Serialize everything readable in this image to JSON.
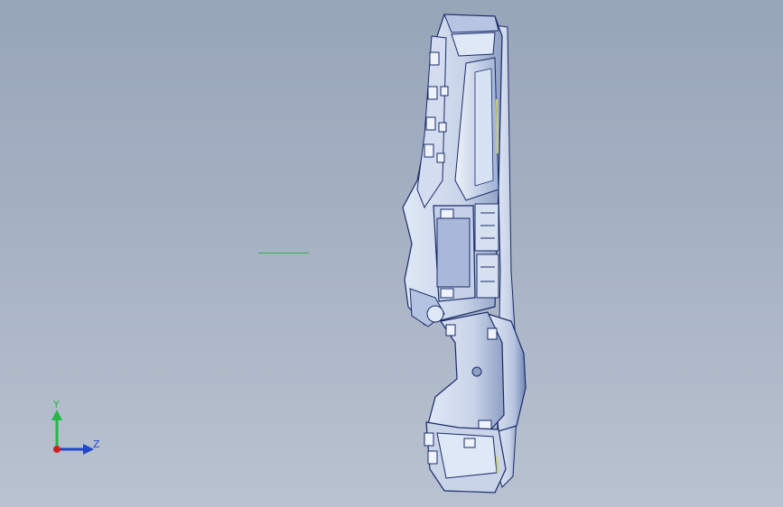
{
  "viewport": {
    "background_top": "#97a5b9",
    "background_bottom": "#b9c2d0"
  },
  "model": {
    "edge_color": "#1b2b6a",
    "face_color": "#c9d4e8",
    "highlight_color": "#dfe8f6",
    "shadow_color": "#8fa0c4"
  },
  "sketch_line": {
    "color": "#2bb24a"
  },
  "triad": {
    "y_label": "Y",
    "z_label": "Z",
    "y_color": "#25b847",
    "z_color": "#2147c9",
    "x_color": "#d42020"
  }
}
